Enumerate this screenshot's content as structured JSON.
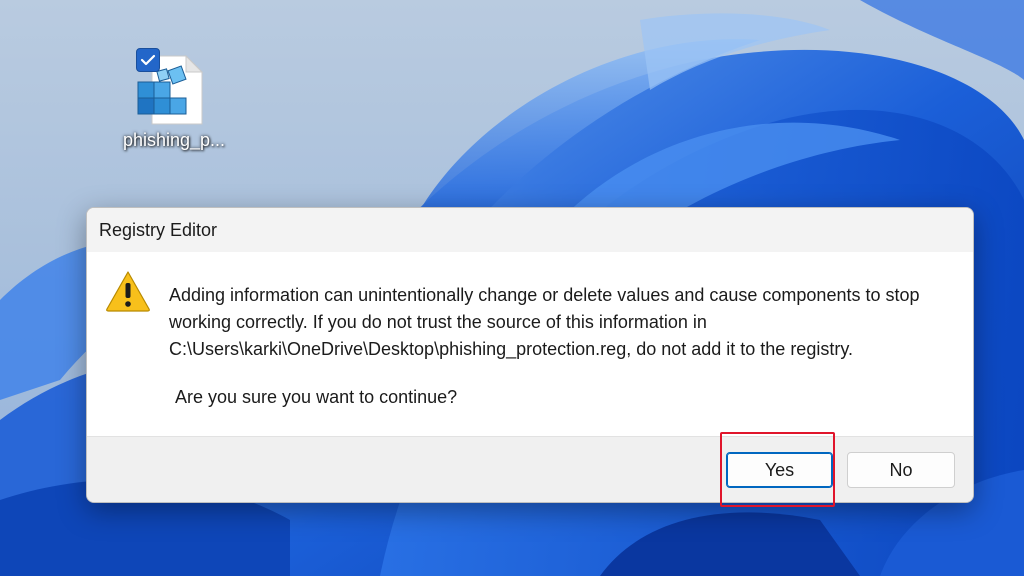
{
  "desktop": {
    "icon": {
      "label": "phishing_p...",
      "icon_name": "registry-file-icon",
      "selected": true
    }
  },
  "dialog": {
    "title": "Registry Editor",
    "icon_name": "warning-icon",
    "message": "Adding information can unintentionally change or delete values and cause components to stop working correctly. If you do not trust the source of this information in C:\\Users\\karki\\OneDrive\\Desktop\\phishing_protection.reg, do not add it to the registry.",
    "question": "Are you sure you want to continue?",
    "buttons": {
      "yes_label": "Yes",
      "no_label": "No"
    }
  },
  "annotation": {
    "highlight_color": "#e0152b",
    "highlighted": "Yes"
  },
  "colors": {
    "accent": "#0067c0",
    "warning": "#f8c01b"
  }
}
